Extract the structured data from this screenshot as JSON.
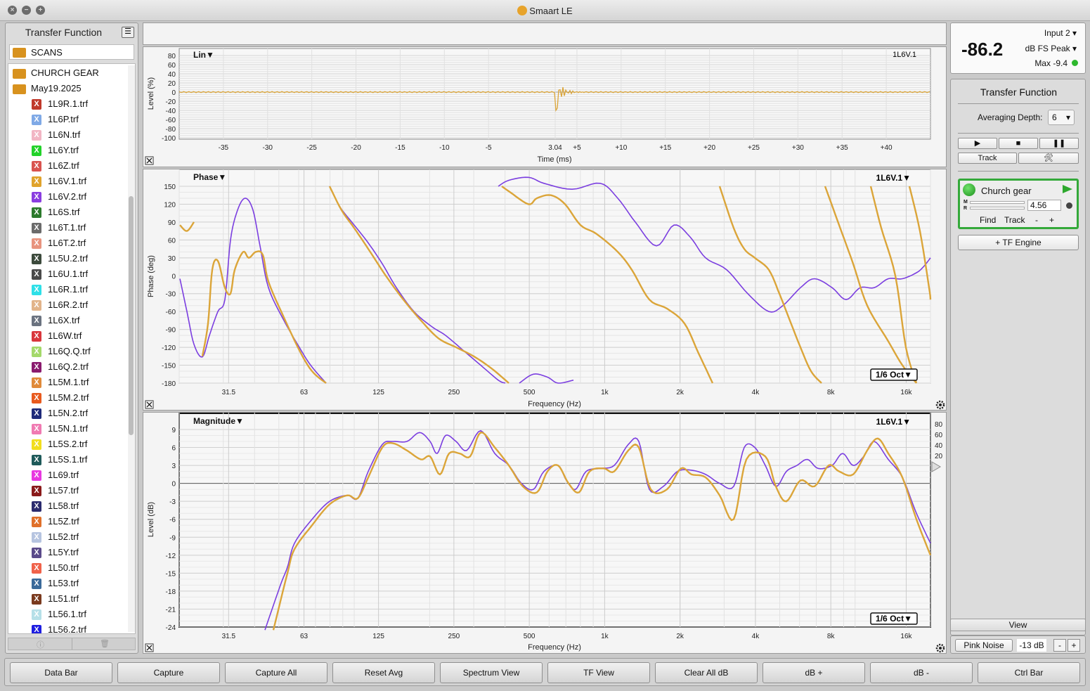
{
  "app": {
    "title": "Smaart LE"
  },
  "left_panel": {
    "title": "Transfer Function",
    "root_folder": "SCANS",
    "tree": [
      {
        "type": "folder",
        "label": "CHURCH GEAR"
      },
      {
        "type": "folder",
        "label": "May19.2025"
      },
      {
        "type": "file",
        "label": "1L9R.1.trf",
        "color": "#c0392b"
      },
      {
        "type": "file",
        "label": "1L6P.trf",
        "color": "#7fa9e6"
      },
      {
        "type": "file",
        "label": "1L6N.trf",
        "color": "#f2b6c4"
      },
      {
        "type": "file",
        "label": "1L6Y.trf",
        "color": "#22d22a"
      },
      {
        "type": "file",
        "label": "1L6Z.trf",
        "color": "#d9534f"
      },
      {
        "type": "file",
        "label": "1L6V.1.trf",
        "color": "#e0a32c"
      },
      {
        "type": "file",
        "label": "1L6V.2.trf",
        "color": "#8a3de0"
      },
      {
        "type": "file",
        "label": "1L6S.trf",
        "color": "#2c7a2c"
      },
      {
        "type": "file",
        "label": "1L6T.1.trf",
        "color": "#6b6b6b"
      },
      {
        "type": "file",
        "label": "1L6T.2.trf",
        "color": "#e8947f"
      },
      {
        "type": "file",
        "label": "1L5U.2.trf",
        "color": "#3c4a3c"
      },
      {
        "type": "file",
        "label": "1L6U.1.trf",
        "color": "#4a4a4a"
      },
      {
        "type": "file",
        "label": "1L6R.1.trf",
        "color": "#2ee0e8"
      },
      {
        "type": "file",
        "label": "1L6R.2.trf",
        "color": "#e2b48a"
      },
      {
        "type": "file",
        "label": "1L6X.trf",
        "color": "#6b7380"
      },
      {
        "type": "file",
        "label": "1L6W.trf",
        "color": "#d9363c"
      },
      {
        "type": "file",
        "label": "1L6Q.Q.trf",
        "color": "#a4d96a"
      },
      {
        "type": "file",
        "label": "1L6Q.2.trf",
        "color": "#8a1a6e"
      },
      {
        "type": "file",
        "label": "1L5M.1.trf",
        "color": "#e08a3a"
      },
      {
        "type": "file",
        "label": "1L5M.2.trf",
        "color": "#e85a1e"
      },
      {
        "type": "file",
        "label": "1L5N.2.trf",
        "color": "#1e2a7a"
      },
      {
        "type": "file",
        "label": "1L5N.1.trf",
        "color": "#f07ab2"
      },
      {
        "type": "file",
        "label": "1L5S.2.trf",
        "color": "#f2de1e"
      },
      {
        "type": "file",
        "label": "1L5S.1.trf",
        "color": "#1e5a5a"
      },
      {
        "type": "file",
        "label": "1L69.trf",
        "color": "#e838e0"
      },
      {
        "type": "file",
        "label": "1L57.trf",
        "color": "#8a1a1a"
      },
      {
        "type": "file",
        "label": "1L58.trf",
        "color": "#2a2a6e"
      },
      {
        "type": "file",
        "label": "1L5Z.trf",
        "color": "#e0702a"
      },
      {
        "type": "file",
        "label": "1L52.trf",
        "color": "#b6c4e0"
      },
      {
        "type": "file",
        "label": "1L5Y.trf",
        "color": "#5a4a8a"
      },
      {
        "type": "file",
        "label": "1L50.trf",
        "color": "#f0624a"
      },
      {
        "type": "file",
        "label": "1L53.trf",
        "color": "#3a6a9a"
      },
      {
        "type": "file",
        "label": "1L51.trf",
        "color": "#7a3a1e"
      },
      {
        "type": "file",
        "label": "1L56.1.trf",
        "color": "#b6e0e8"
      },
      {
        "type": "file",
        "label": "1L56.2.trf",
        "color": "#1e1ee0"
      }
    ],
    "info_glyph": "ⓘ",
    "trash_glyph": "🗑"
  },
  "impulse_plot": {
    "title": "Lin▼",
    "measurement": "1L6V.1",
    "ylabel": "Level (%)",
    "xlabel": "Time (ms)",
    "yticks": [
      "80",
      "60",
      "40",
      "20",
      "0",
      "-20",
      "-40",
      "-60",
      "-80",
      "-100"
    ],
    "xticks": [
      "-35",
      "-30",
      "-25",
      "-20",
      "-15",
      "-10",
      "-5",
      "3.04",
      "+5",
      "+10",
      "+15",
      "+20",
      "+25",
      "+30",
      "+35",
      "+40"
    ]
  },
  "phase_plot": {
    "title": "Phase▼",
    "measurement": "1L6V.1▼",
    "ylabel": "Phase (deg)",
    "xlabel": "Frequency (Hz)",
    "yticks": [
      "150",
      "120",
      "90",
      "60",
      "30",
      "0",
      "-30",
      "-60",
      "-90",
      "-120",
      "-150",
      "-180"
    ],
    "xticks": [
      "31.5",
      "63",
      "125",
      "250",
      "500",
      "1k",
      "2k",
      "4k",
      "8k",
      "16k"
    ],
    "smoothing": "1/6 Oct▼"
  },
  "magnitude_plot": {
    "title": "Magnitude▼",
    "measurement": "1L6V.1▼",
    "ylabel": "Level (dB)",
    "xlabel": "Frequency (Hz)",
    "yticks": [
      "9",
      "6",
      "3",
      "0",
      "-3",
      "-6",
      "-9",
      "-12",
      "-15",
      "-18",
      "-21",
      "-24"
    ],
    "xticks": [
      "31.5",
      "63",
      "125",
      "250",
      "500",
      "1k",
      "2k",
      "4k",
      "8k",
      "16k"
    ],
    "right_ticks": [
      "80",
      "60",
      "40",
      "20"
    ],
    "smoothing": "1/6 Oct▼"
  },
  "meter": {
    "value": "-86.2",
    "input": "Input 2",
    "mode": "dB FS Peak",
    "max": "Max -9.4",
    "dropdown": "▾",
    "status_color": "#2eb82e"
  },
  "tf_panel": {
    "title": "Transfer Function",
    "averaging_label": "Averaging Depth:",
    "averaging_value": "6",
    "dropdown": "▾",
    "play": "▶",
    "stop": "■",
    "pause": "❚❚",
    "track_label": "Track",
    "tools_glyph": "🛠",
    "engine": {
      "name": "Church gear",
      "delay": "4.56",
      "meter_m": "M",
      "meter_r": "R",
      "find_label": "Find",
      "track_label": "Track",
      "minus": "-",
      "plus": "+"
    },
    "add_engine_label": "+ TF Engine"
  },
  "view_label": "View",
  "generator": {
    "label": "Pink Noise",
    "level": "-13 dB",
    "minus": "-",
    "plus": "+"
  },
  "bottom_bar": [
    "Data Bar",
    "Capture",
    "Capture All",
    "Reset Avg",
    "Spectrum View",
    "TF View",
    "Clear All dB",
    "dB +",
    "dB -",
    "Ctrl Bar"
  ],
  "colors": {
    "trace_gold": "#dba539",
    "trace_purple": "#7b3ee0",
    "engine_green": "#34a93a"
  }
}
